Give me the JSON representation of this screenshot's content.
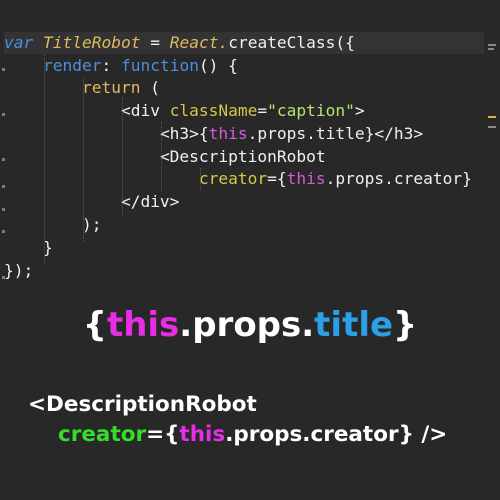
{
  "editor": {
    "lines": [
      {
        "indent": "",
        "parts": [
          "var",
          " ",
          "TitleRobot",
          " = ",
          "React.",
          "createClass({"
        ]
      },
      {
        "indent": "    ",
        "parts": [
          "render",
          ": ",
          "function",
          "() {"
        ]
      },
      {
        "indent": "        ",
        "parts": [
          "return",
          " ("
        ]
      },
      {
        "indent": "            ",
        "parts": [
          "<div ",
          "className",
          "=",
          "\"caption\"",
          ">"
        ]
      },
      {
        "indent": "                ",
        "parts": [
          "<h3>",
          "{",
          "this",
          ".props.title}",
          "</h3>"
        ]
      },
      {
        "indent": "                ",
        "parts": [
          "<DescriptionRobot"
        ]
      },
      {
        "indent": "                    ",
        "parts": [
          "creator",
          "=",
          "{",
          "this",
          ".props.creator}"
        ]
      },
      {
        "indent": "            ",
        "parts": [
          "</div>"
        ]
      },
      {
        "indent": "        ",
        "parts": [
          ");"
        ]
      },
      {
        "indent": "    ",
        "parts": [
          "}"
        ]
      },
      {
        "indent": "",
        "parts": [
          "});"
        ]
      }
    ]
  },
  "caption": {
    "title_brace_open": "{",
    "title_this": "this",
    "title_props": ".props.",
    "title_word": "title",
    "title_brace_close": "}",
    "desc_line": "<DescriptionRobot",
    "creator_attr": "creator",
    "creator_eq": "=",
    "creator_brace_open": "{",
    "creator_this": "this",
    "creator_rest": ".props.creator} />"
  },
  "colors": {
    "keyword": "#4f8edc",
    "string": "#b9e36b",
    "attribute": "#d8c64a",
    "this_highlight": "#e62ee6",
    "title_highlight": "#2aa0e6",
    "creator_highlight": "#35dc2a"
  }
}
